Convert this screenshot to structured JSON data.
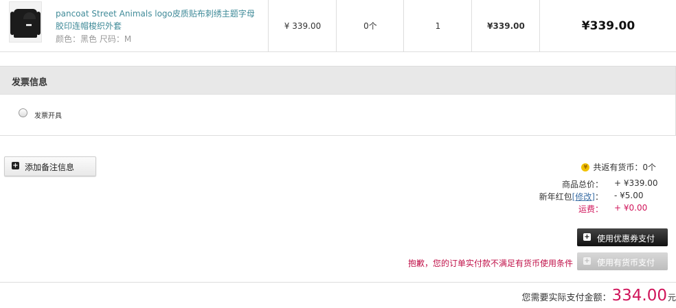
{
  "product": {
    "name": "pancoat Street Animals logo皮质贴布刺绣主题字母胶印连帽梭织外套",
    "attributes": "颜色：黑色 尺码：M",
    "unit_price": "¥ 339.00",
    "coins": "0个",
    "quantity": "1",
    "subtotal": "¥339.00",
    "total": "¥339.00"
  },
  "invoice": {
    "title": "发票信息",
    "option_label": "发票开具"
  },
  "memo_button_label": "添加备注信息",
  "summary": {
    "coins_text": "共返有货币：0个",
    "goods_total_label": "商品总价：",
    "goods_total_value": "+ ¥339.00",
    "red_packet_label": "新年红包",
    "red_packet_modify": "[修改]",
    "red_packet_colon": "：",
    "red_packet_value": "- ¥5.00",
    "shipping_label": "运费：",
    "shipping_value": "+ ¥0.00"
  },
  "coupon_button_label": "使用优惠券支付",
  "coin_button_label": "使用有货币支付",
  "coin_warning": "抱歉，您的订单实付款不满足有货币使用条件",
  "payable": {
    "label": "您需要实际支付金额：",
    "amount": "334.00",
    "unit": "元"
  },
  "colors": {
    "accent_pink": "#d0145a",
    "link_teal": "#3f8a98"
  }
}
